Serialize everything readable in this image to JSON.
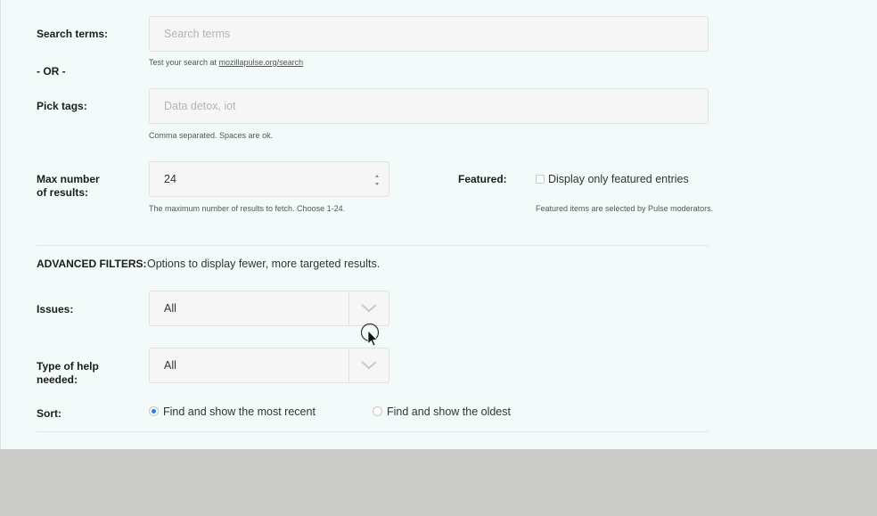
{
  "search": {
    "label": "Search terms:",
    "placeholder": "Search terms",
    "help_prefix": "Test your search at ",
    "help_link": "mozillapulse.org/search"
  },
  "or_label": "- OR -",
  "tags": {
    "label": "Pick tags:",
    "placeholder": "Data detox, iot",
    "help": "Comma separated. Spaces are ok."
  },
  "max_results": {
    "label_line1": "Max number",
    "label_line2": "of results:",
    "value": "24",
    "help": "The maximum number of results to fetch. Choose 1-24."
  },
  "featured": {
    "label": "Featured:",
    "checkbox_label": "Display only featured entries",
    "checked": false,
    "help": "Featured items are selected by Pulse moderators."
  },
  "advanced": {
    "label": "ADVANCED FILTERS:",
    "description": "Options to display fewer, more targeted results."
  },
  "issues": {
    "label": "Issues:",
    "selected": "All"
  },
  "help_type": {
    "label_line1": "Type of help",
    "label_line2": "needed:",
    "selected": "All"
  },
  "sort": {
    "label": "Sort:",
    "options": [
      {
        "label": "Find and show the most recent",
        "checked": true
      },
      {
        "label": "Find and show the oldest",
        "checked": false
      }
    ]
  },
  "colors": {
    "panel_bg": "#f3fafa",
    "page_bg": "#cbcbca",
    "radio_accent": "#2b7de9"
  }
}
